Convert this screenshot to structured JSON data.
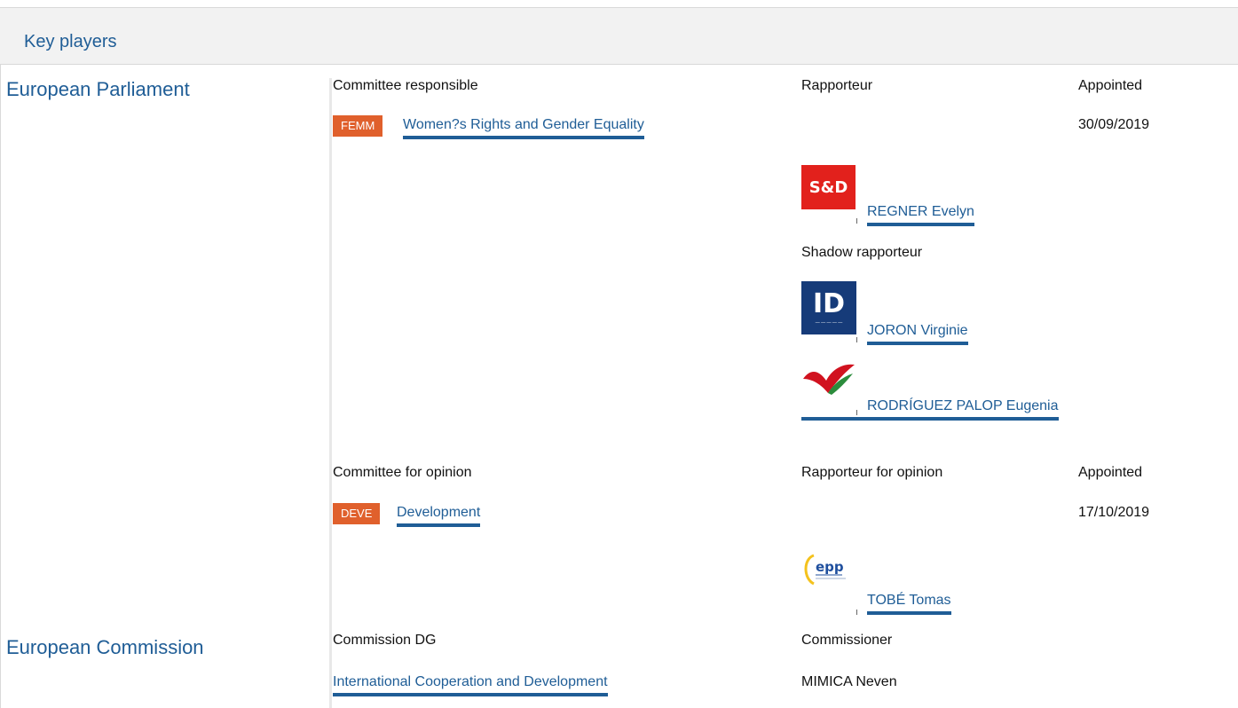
{
  "panel": {
    "title": "Key players"
  },
  "parliament": {
    "name": "European Parliament",
    "responsible": {
      "header_committee": "Committee responsible",
      "header_rapporteur": "Rapporteur",
      "header_appointed": "Appointed",
      "committee_code": "FEMM",
      "committee_name": "Women?s Rights and Gender Equality",
      "appointed_date": "30/09/2019",
      "rapporteur": {
        "group_logo": "s-and-d-logo",
        "logo_text": "S&D",
        "name": "REGNER Evelyn"
      },
      "shadow_label": "Shadow rapporteur",
      "shadows": [
        {
          "group_logo": "id-group-logo",
          "logo_text": "ID",
          "name": "JORON Virginie"
        },
        {
          "group_logo": "gue-ngl-logo",
          "name": "RODRÍGUEZ PALOP Eugenia"
        }
      ]
    },
    "opinion": {
      "header_committee": "Committee for opinion",
      "header_rapporteur": "Rapporteur for opinion",
      "header_appointed": "Appointed",
      "committee_code": "DEVE",
      "committee_name": "Development",
      "appointed_date": "17/10/2019",
      "rapporteur": {
        "group_logo": "epp-logo",
        "logo_text": "epp",
        "name": "TOBÉ Tomas"
      }
    }
  },
  "commission": {
    "name": "European Commission",
    "header_dg": "Commission DG",
    "header_commissioner": "Commissioner",
    "dg_name": "International Cooperation and Development",
    "commissioner": "MIMICA Neven"
  },
  "colors": {
    "accent": "#1f5d96",
    "badge": "#e0602c",
    "sd_red": "#e2211c",
    "id_blue": "#163b79"
  }
}
